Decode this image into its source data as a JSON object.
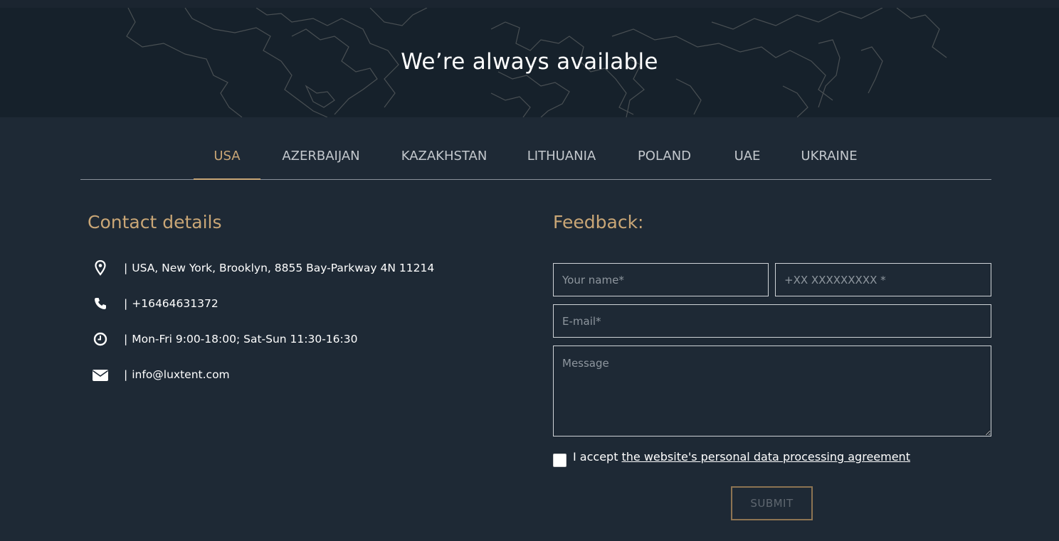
{
  "hero": {
    "title": "We’re always available"
  },
  "tabs": [
    {
      "label": "USA",
      "active": true
    },
    {
      "label": "AZERBAIJAN",
      "active": false
    },
    {
      "label": "KAZAKHSTAN",
      "active": false
    },
    {
      "label": "LITHUANIA",
      "active": false
    },
    {
      "label": "POLAND",
      "active": false
    },
    {
      "label": "UAE",
      "active": false
    },
    {
      "label": "UKRAINE",
      "active": false
    }
  ],
  "contact": {
    "title": "Contact details",
    "separator": "|",
    "address": "USA, New York, Brooklyn, 8855 Bay-Parkway 4N 11214",
    "phone": "+16464631372",
    "hours": "Mon-Fri 9:00-18:00; Sat-Sun 11:30-16:30",
    "email": "info@luxtent.com"
  },
  "feedback": {
    "title": "Feedback:",
    "name_placeholder": "Your name*",
    "phone_placeholder": "+XX XXXXXXXXX *",
    "email_placeholder": "E-mail*",
    "message_placeholder": "Message",
    "consent_prefix": "I accept",
    "consent_link": "the website's personal data processing agreement",
    "submit_label": "SUBMIT"
  },
  "colors": {
    "accent": "#c9a676",
    "background": "#1e2935",
    "hero_background": "#16212b"
  }
}
